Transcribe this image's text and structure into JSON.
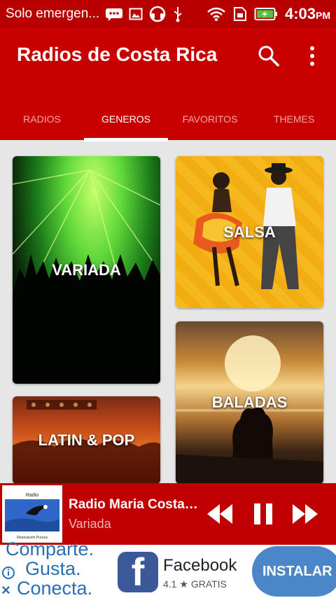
{
  "status_bar": {
    "carrier": "Solo emergen...",
    "time": "4:03",
    "ampm": "PM",
    "icons": [
      "messages-icon",
      "gallery-icon",
      "headset-icon",
      "usb-icon",
      "wifi-icon",
      "sim-icon",
      "battery-charging-icon"
    ]
  },
  "appbar": {
    "title": "Radios de Costa Rica",
    "tabs": [
      {
        "label": "RADIOS",
        "active": false
      },
      {
        "label": "GENEROS",
        "active": true
      },
      {
        "label": "FAVORITOS",
        "active": false
      },
      {
        "label": "THEMES",
        "active": false
      }
    ]
  },
  "genres": {
    "variada": "VARIADA",
    "salsa": "SALSA",
    "baladas": "BALADAS",
    "latin_pop": "LATIN & POP"
  },
  "player": {
    "station": "Radio Maria Costa Rica",
    "genre": "Variada",
    "thumb_title": "Radio",
    "thumb_caption": "Renovación Pureza"
  },
  "ad": {
    "slogan": [
      "Comparte.",
      "Gusta.",
      "Conecta."
    ],
    "app_name": "Facebook",
    "rating": "4.1",
    "price": "GRATIS",
    "cta": "INSTALAR"
  },
  "colors": {
    "primary": "#c90000",
    "status_bar": "#b80000",
    "ad_blue": "#4a86c8"
  }
}
